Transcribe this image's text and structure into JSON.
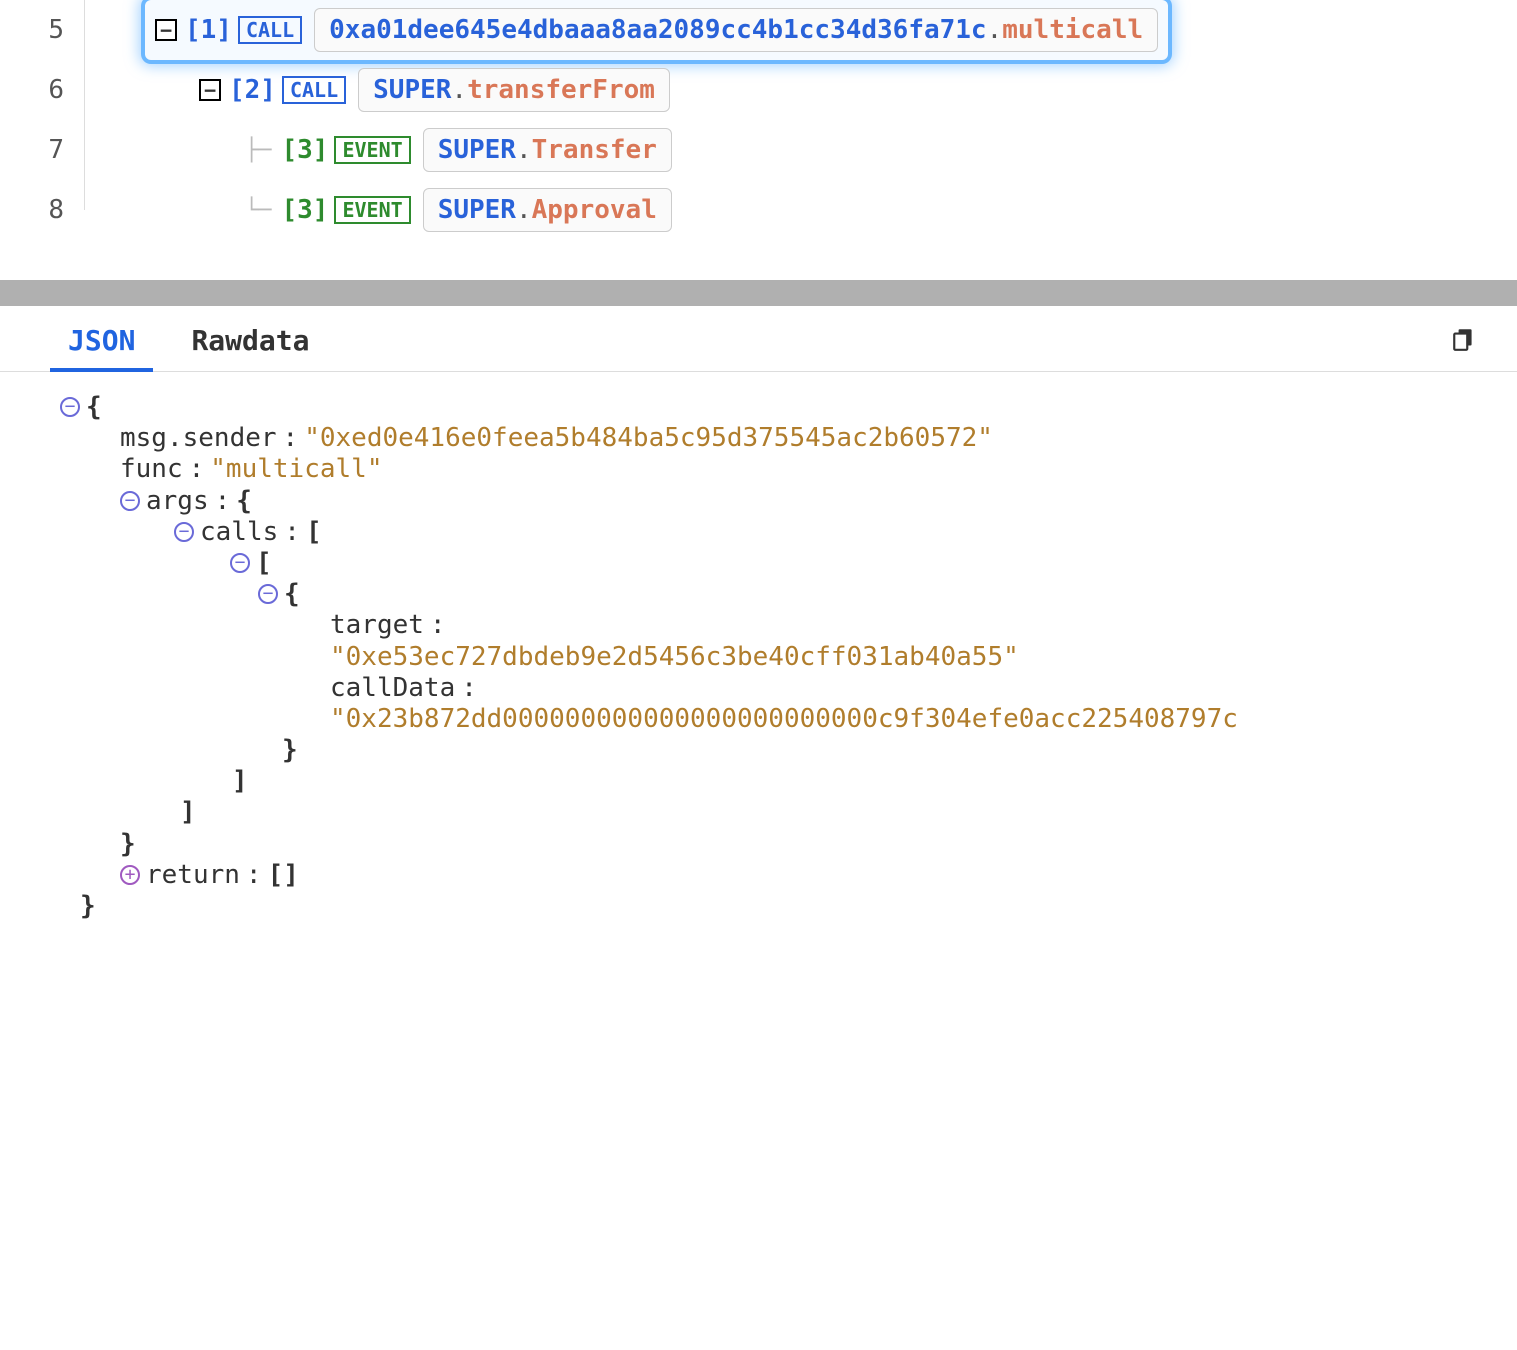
{
  "trace": {
    "rows": [
      {
        "line": "5",
        "indent": 60,
        "expander": "−",
        "depth": "[1]",
        "depthClass": "depth",
        "kind": "CALL",
        "kindClass": "kind-call",
        "contract": "0xa01dee645e4dbaaa8aa2089cc4b1cc34d36fa71c",
        "method": "multicall",
        "selected": true,
        "conn": ""
      },
      {
        "line": "6",
        "indent": 108,
        "expander": "−",
        "depth": "[2]",
        "depthClass": "depth",
        "kind": "CALL",
        "kindClass": "kind-call",
        "contract": "SUPER",
        "method": "transferFrom",
        "selected": false,
        "conn": ""
      },
      {
        "line": "7",
        "indent": 156,
        "expander": "",
        "depth": "[3]",
        "depthClass": "depth green",
        "kind": "EVENT",
        "kindClass": "kind-event",
        "contract": "SUPER",
        "method": "Transfer",
        "selected": false,
        "conn": "├─"
      },
      {
        "line": "8",
        "indent": 156,
        "expander": "",
        "depth": "[3]",
        "depthClass": "depth green",
        "kind": "EVENT",
        "kindClass": "kind-event",
        "contract": "SUPER",
        "method": "Approval",
        "selected": false,
        "conn": "└─"
      }
    ]
  },
  "tabs": {
    "json": "JSON",
    "raw": "Rawdata"
  },
  "json": {
    "msg_sender_key": "msg.sender",
    "msg_sender_val": "\"0xed0e416e0feea5b484ba5c95d375545ac2b60572\"",
    "func_key": "func",
    "func_val": "\"multicall\"",
    "args_key": "args",
    "calls_key": "calls",
    "target_key": "target",
    "target_val": "\"0xe53ec727dbdeb9e2d5456c3be40cff031ab40a55\"",
    "calldata_key": "callData",
    "calldata_val": "\"0x23b872dd000000000000000000000000c9f304efe0acc225408797c",
    "return_key": "return",
    "return_val": "[]"
  }
}
